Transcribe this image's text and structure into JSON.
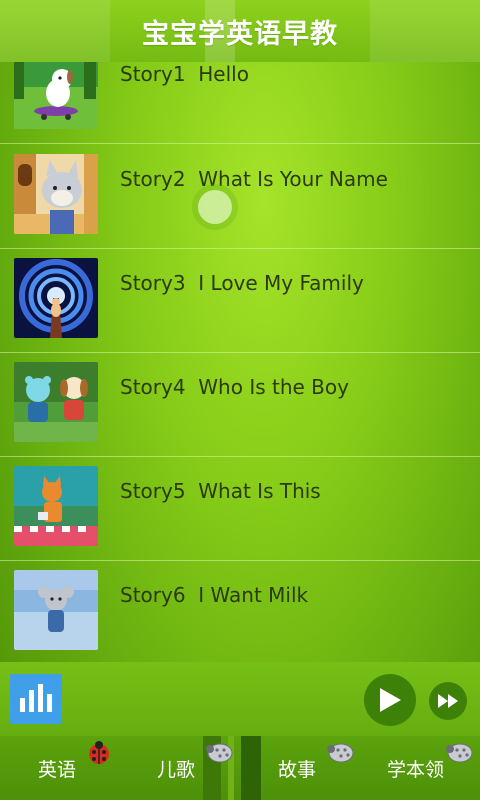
{
  "header": {
    "title": "宝宝学英语早教"
  },
  "stories": [
    {
      "label": "Story1  Hello",
      "thumb": "dog-skateboard-thumbnail"
    },
    {
      "label": "Story2  What Is Your Name",
      "thumb": "cat-door-thumbnail"
    },
    {
      "label": "Story3  I Love My Family",
      "thumb": "tunnel-thumbnail"
    },
    {
      "label": "Story4  Who Is the Boy",
      "thumb": "bear-dog-thumbnail"
    },
    {
      "label": "Story5  What Is This",
      "thumb": "cat-picnic-thumbnail"
    },
    {
      "label": "Story6  I Want Milk",
      "thumb": "mouse-thumbnail"
    }
  ],
  "player": {
    "eq_icon": "equalizer-icon",
    "play_icon": "play-icon",
    "next_icon": "fast-forward-icon"
  },
  "tabs": [
    {
      "label": "英语",
      "bug": "ladybug-icon"
    },
    {
      "label": "儿歌",
      "bug": "bug-icon"
    },
    {
      "label": "故事",
      "bug": "bug-icon"
    },
    {
      "label": "学本领",
      "bug": "bug-icon"
    }
  ],
  "colors": {
    "accent_green": "#86cc18",
    "play_button": "#3e8108",
    "eq_button": "#3f9fe8",
    "text": "#2c3a0c"
  }
}
